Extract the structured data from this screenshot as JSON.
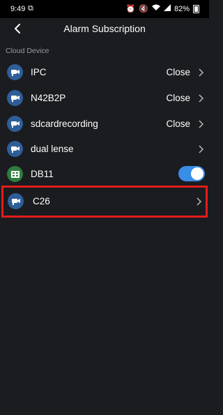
{
  "status_bar": {
    "time": "9:49",
    "battery": "82%"
  },
  "header": {
    "title": "Alarm Subscription"
  },
  "section": {
    "label": "Cloud Device"
  },
  "devices": [
    {
      "name": "IPC",
      "status": "Close",
      "icon": "camera-icon"
    },
    {
      "name": "N42B2P",
      "status": "Close",
      "icon": "camera-icon"
    },
    {
      "name": "sdcardrecording",
      "status": "Close",
      "icon": "camera-icon"
    },
    {
      "name": "dual lense",
      "status": "",
      "icon": "camera-icon"
    },
    {
      "name": "DB11",
      "status": "",
      "icon": "doorbell-icon",
      "toggle_on": true
    },
    {
      "name": "C26",
      "status": "",
      "icon": "camera-icon",
      "highlighted": true
    }
  ],
  "colors": {
    "background": "#1b1c20",
    "accent": "#3a8de6",
    "highlight_border": "#e21c1c"
  }
}
